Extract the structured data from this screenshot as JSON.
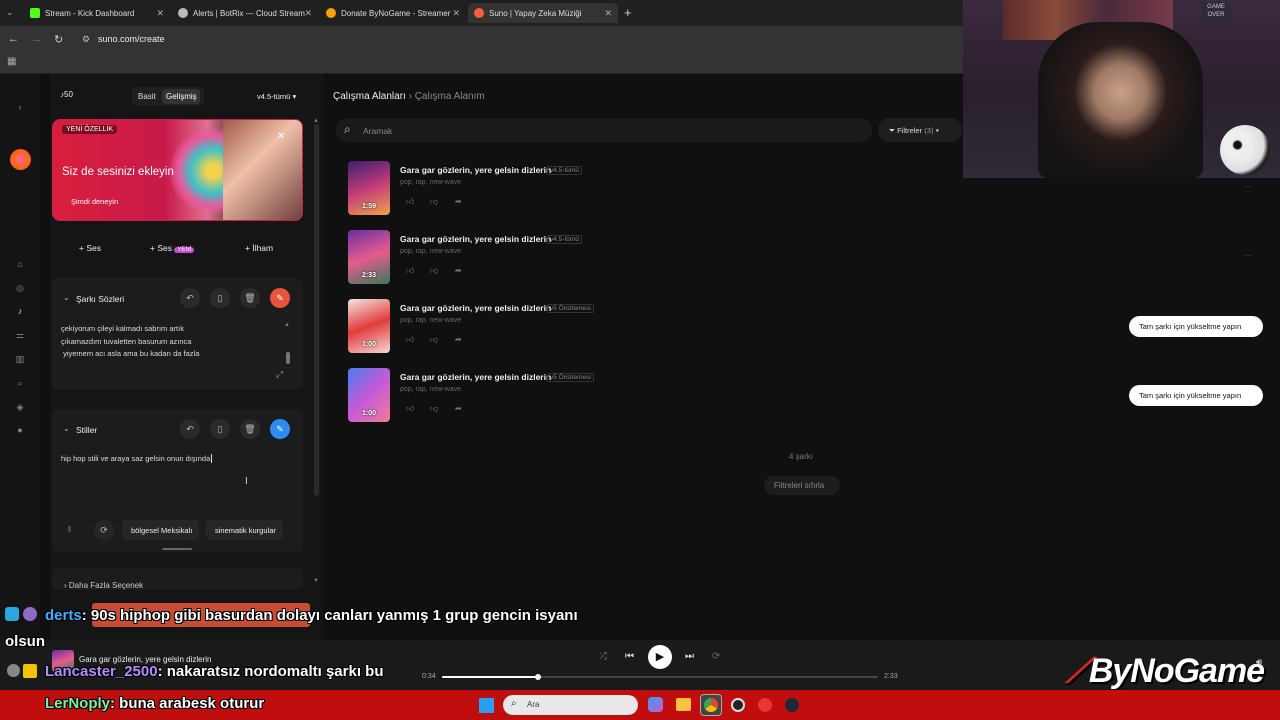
{
  "tabs": [
    {
      "label": "Stream - Kick Dashboard",
      "color": "#53fc18"
    },
    {
      "label": "Alerts | BotRix — Cloud Stream",
      "color": "#bbbbbb"
    },
    {
      "label": "Donate ByNoGame - Streamer",
      "color": "#f4a300"
    },
    {
      "label": "Suno | Yapay Zeka Müziği",
      "color": "#ff5b3a"
    }
  ],
  "address": "suno.com/create",
  "panel": {
    "credits": "50",
    "mode_simple": "Basit",
    "mode_advanced": "Gelişmiş",
    "version": "v4.5-tümü",
    "promo_badge": "YENİ ÖZELLİK",
    "promo_title": "Siz de sesinizi ekleyin",
    "promo_cta": "Şimdi deneyin",
    "add_buttons": [
      "Ses",
      "Ses",
      "İlham"
    ],
    "add_new_badge": "YENİ",
    "lyrics_title": "Şarkı Sözleri",
    "lyrics_lines": [
      "çekiyorum çileyi kalmadı sabrım artık",
      "çıkamazdım tuvaletten basurum azınca",
      " yiyemem acı asla ama bu kadarı da fazla"
    ],
    "styles_title": "Stiller",
    "styles_text": "hip hop stili ve araya saz gelsin onun dışında",
    "style_chips": [
      "bölgesel Meksikalı",
      "sinematik kurgular"
    ],
    "more_options": "Daha Fazla Seçenek"
  },
  "main": {
    "breadcrumb_root": "Çalışma Alanları",
    "breadcrumb_current": "Çalışma Alanım",
    "search_placeholder": "Aramak",
    "filters_label": "Filtreler",
    "filters_count": "(3)",
    "songs": [
      {
        "title": "Gara gar gözlerin, yere gelsin dizlerin",
        "version": "v4.5-tümü",
        "tags": "pop, rap, new-wave",
        "duration": "1:59",
        "gradient": "linear-gradient(160deg,#3a1f6e,#c23b7a 50%,#f0a34a)"
      },
      {
        "title": "Gara gar gözlerin, yere gelsin dizlerin",
        "version": "v4.5-tümü",
        "tags": "pop, rap, new-wave",
        "duration": "2:33",
        "gradient": "linear-gradient(160deg,#6b2fa0,#e35c8e 50%,#3a7a5a)"
      },
      {
        "title": "Gara gar gözlerin, yere gelsin dizlerin",
        "version": "v5 Önizlemesi",
        "tags": "pop, rap, new-wave",
        "duration": "1:00",
        "gradient": "linear-gradient(160deg,#f3e6e6,#e23b3b 50%,#f5d7d7)"
      },
      {
        "title": "Gara gar gözlerin, yere gelsin dizlerin",
        "version": "v5 Önizlemesi",
        "tags": "pop, rap, new-wave",
        "duration": "1:00",
        "gradient": "linear-gradient(135deg,#4a7af0,#c45bd6 50%,#f07a9a)"
      }
    ],
    "count_label": "4 şarkı",
    "reset_filters": "Filtreleri sıfırla",
    "upgrade_label": "Tam şarkı için yükseltme yapın"
  },
  "player": {
    "song_title": "Gara gar gözlerin, yere gelsin dizlerin",
    "elapsed": "0:34",
    "total": "2:33",
    "progress_fraction": 0.22
  },
  "chat": [
    {
      "user": "derts",
      "message": ": 90s hiphop gibi basurdan dolayı canları yanmış 1 grup gencin isyanı"
    },
    {
      "user": "",
      "message": "olsun"
    },
    {
      "user": "Lancaster_2500",
      "message": ": nakaratsız nordomaltı şarkı bu"
    },
    {
      "user": "LerNoply",
      "message": ": buna arabesk oturur"
    }
  ],
  "brand": "ByNoGame",
  "webcam_sign": "GAME OVER",
  "taskbar": {
    "search": "Ara"
  }
}
